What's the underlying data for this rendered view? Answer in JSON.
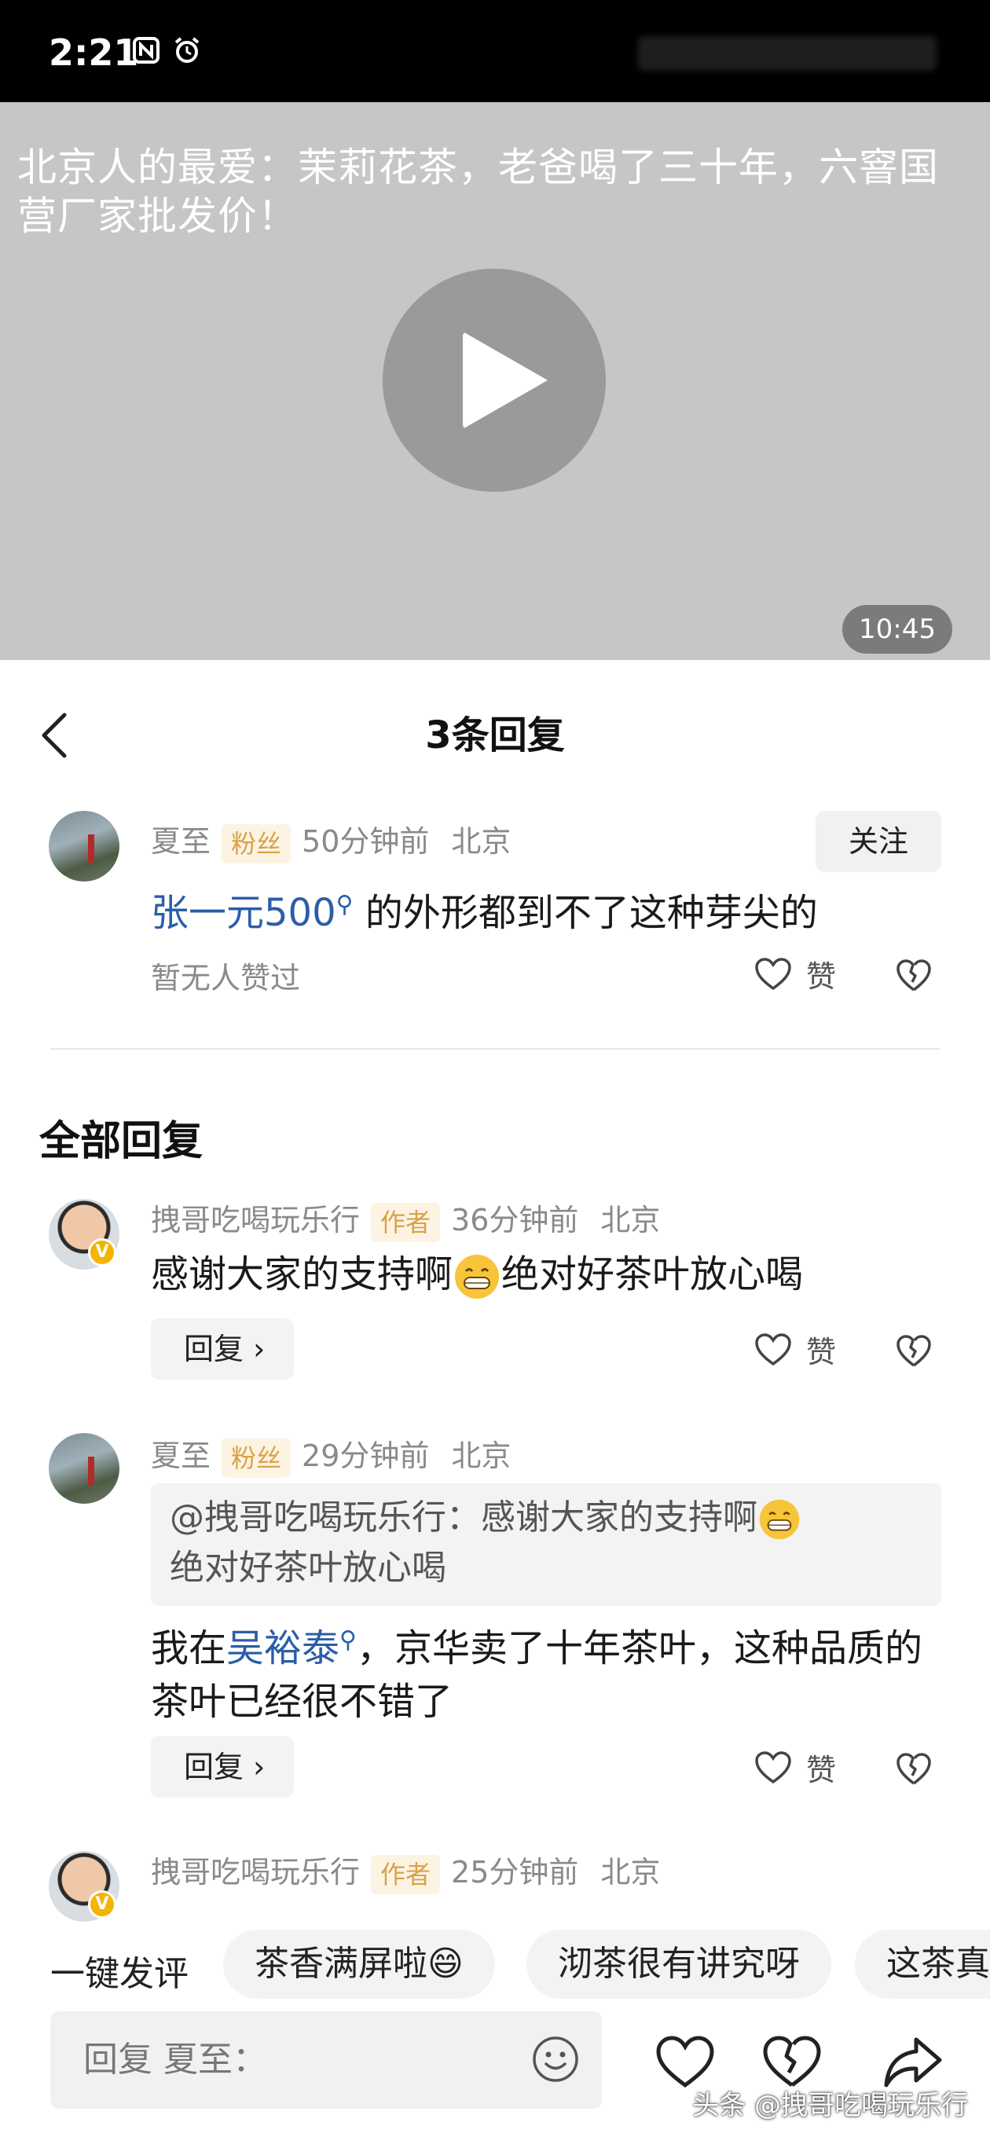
{
  "status_bar": {
    "time": "2:21"
  },
  "video": {
    "title": "北京人的最爱：茉莉花茶，老爸喝了三十年，六窨国营厂家批发价！",
    "duration": "10:45"
  },
  "header": {
    "title": "3条回复"
  },
  "main_comment": {
    "user": "夏至",
    "tag": "粉丝",
    "time": "50分钟前",
    "location": "北京",
    "follow_label": "关注",
    "mention": "张一元500",
    "text": " 的外形都到不了这种芽尖的",
    "likes_text": "暂无人赞过",
    "like_label": "赞"
  },
  "section_title": "全部回复",
  "replies": [
    {
      "user": "拽哥吃喝玩乐行",
      "tag": "作者",
      "time": "36分钟前",
      "location": "北京",
      "text_a": "感谢大家的支持啊",
      "text_b": "绝对好茶叶放心喝",
      "reply_label": "回复",
      "like_label": "赞"
    },
    {
      "user": "夏至",
      "tag": "粉丝",
      "time": "29分钟前",
      "location": "北京",
      "quote_a": "@拽哥吃喝玩乐行：感谢大家的支持啊",
      "quote_b": "绝对好茶叶放心喝",
      "text_prefix": "我在",
      "mention": "吴裕泰",
      "text_suffix": "，京华卖了十年茶叶，这种品质的茶叶已经很不错了",
      "reply_label": "回复",
      "like_label": "赞"
    },
    {
      "user": "拽哥吃喝玩乐行",
      "tag": "作者",
      "time": "25分钟前",
      "location": "北京"
    }
  ],
  "quick_replies": {
    "label": "一键发评",
    "chips": [
      "茶香满屏啦😄",
      "沏茶很有讲究呀",
      "这茶真"
    ]
  },
  "bottom_bar": {
    "input_placeholder": "回复 夏至：",
    "watermark": "头条 @拽哥吃喝玩乐行"
  },
  "colors": {
    "mention": "#2a5ea8",
    "tag_bg": "#fdf3e2",
    "tag_text": "#d8a24a"
  }
}
